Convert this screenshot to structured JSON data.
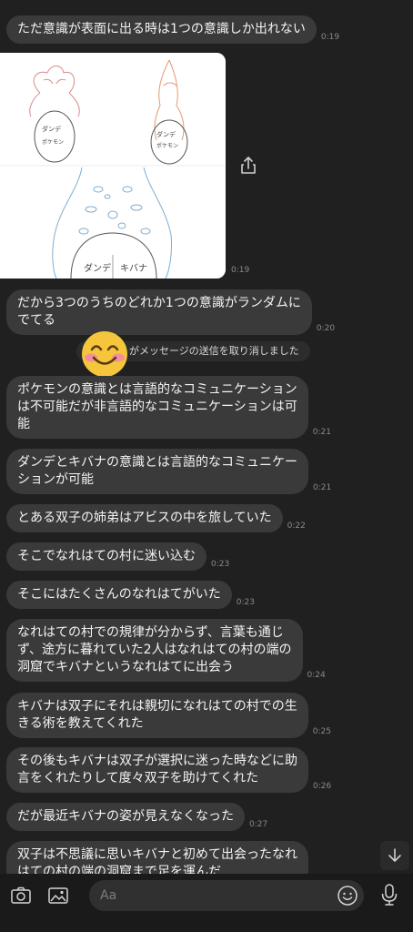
{
  "messages": [
    {
      "text": "ただ意識が表面に出る時は1つの意識しか出れない",
      "time": "0:19"
    },
    {
      "text": "だから3つのうちのどれか1つの意識がランダムに\nでてる",
      "time": "0:20"
    },
    {
      "text": "ポケモンの意識とは言語的なコミュニケーション\nは不可能だが非言語的なコミュニケーションは可\n能",
      "time": "0:21"
    },
    {
      "text": "ダンデとキバナの意識とは言語的なコミュニケー\nションが可能",
      "time": "0:21"
    },
    {
      "text": "とある双子の姉弟はアビスの中を旅していた",
      "time": "0:22"
    },
    {
      "text": "そこでなれはての村に迷い込む",
      "time": "0:23"
    },
    {
      "text": "そこにはたくさんのなれはてがいた",
      "time": "0:23"
    },
    {
      "text": "なれはての村での規律が分からず、言葉も通じ\nず、途方に暮れていた2人はなれはての村の端の\n洞窟でキバナというなれはてに出会う",
      "time": "0:24"
    },
    {
      "text": "キバナは双子にそれは親切になれはての村での生\nきる術を教えてくれた",
      "time": "0:25"
    },
    {
      "text": "その後もキバナは双子が選択に迷った時などに助\n言をくれたりして度々双子を助けてくれた",
      "time": "0:26"
    },
    {
      "text": "だが最近キバナの姿が見えなくなった",
      "time": "0:27"
    },
    {
      "text": "双子は不思議に思いキバナと初めて出会ったなれ\nはての村の端の洞窟まで足を運んだ",
      "time": ""
    }
  ],
  "photo": {
    "time": "0:19",
    "sketch_labels": {
      "left_a": "ダンデ",
      "left_b": "ポケモン",
      "right_a": "ダンデ",
      "right_b": "ポケモン",
      "bottom_a": "ダンデ",
      "bottom_b": "キバナ"
    }
  },
  "system_notice": "がメッセージの送信を取り消しました",
  "composer": {
    "placeholder": "Aa"
  },
  "icons": {
    "camera": "camera-icon",
    "image": "image-icon",
    "emoji": "emoji-icon",
    "mic": "microphone-icon",
    "share": "share-icon",
    "scroll": "arrow-down-icon"
  },
  "colors": {
    "background": "#202020",
    "bubble": "#3a3a3a",
    "bar": "#1a1a1a"
  }
}
